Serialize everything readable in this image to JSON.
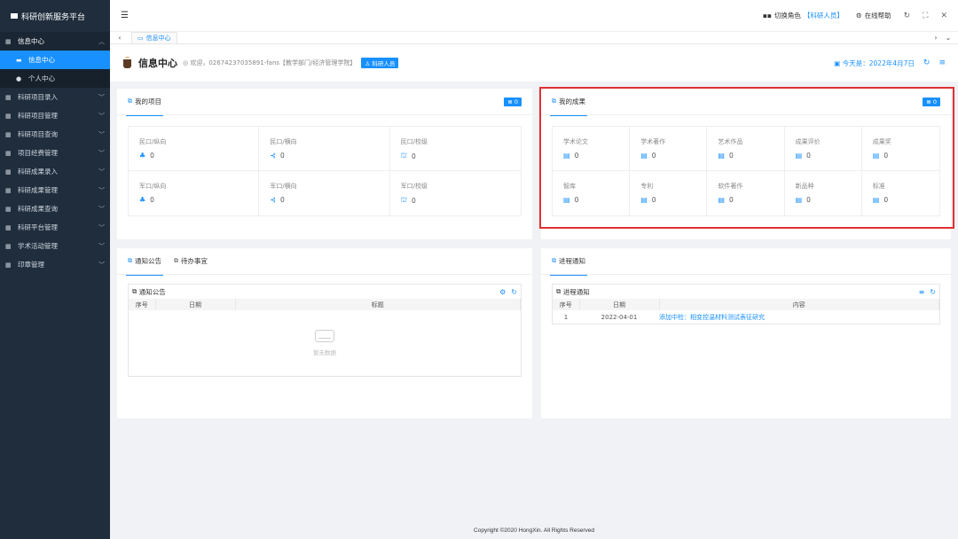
{
  "brand": {
    "title": "科研创新服务平台"
  },
  "sidebar": {
    "items": [
      {
        "label": "信息中心",
        "open": true
      },
      {
        "label": "科研项目录入"
      },
      {
        "label": "科研项目管理"
      },
      {
        "label": "科研项目查询"
      },
      {
        "label": "项目经费管理"
      },
      {
        "label": "科研成果录入"
      },
      {
        "label": "科研成果管理"
      },
      {
        "label": "科研成果查询"
      },
      {
        "label": "科研平台管理"
      },
      {
        "label": "学术活动管理"
      },
      {
        "label": "印章管理"
      }
    ],
    "subitems": [
      {
        "label": "信息中心",
        "active": true
      },
      {
        "label": "个人中心"
      }
    ]
  },
  "topbar": {
    "switch_role_label": "切换角色",
    "role_value": "【科研人员】",
    "help_label": "在线帮助"
  },
  "tabs": [
    {
      "label": "信息中心"
    }
  ],
  "page_header": {
    "title": "信息中心",
    "welcome": "欢迎，02674237035891-fans【教学部门/经济管理学院】",
    "role_badge": "科研人员",
    "today": "今天是：2022年4月7日"
  },
  "my_projects": {
    "title": "我的项目",
    "count": "0",
    "cells": [
      {
        "label": "民口/纵向",
        "value": "0",
        "icon": "hierarchy-icon"
      },
      {
        "label": "民口/横向",
        "value": "0",
        "icon": "share-icon"
      },
      {
        "label": "民口/校级",
        "value": "0",
        "icon": "bank-icon"
      },
      {
        "label": "军口/纵向",
        "value": "0",
        "icon": "hierarchy-icon"
      },
      {
        "label": "军口/横向",
        "value": "0",
        "icon": "share-icon"
      },
      {
        "label": "军口/校级",
        "value": "0",
        "icon": "bank-icon"
      }
    ]
  },
  "my_achievements": {
    "title": "我的成果",
    "count": "0",
    "cells": [
      {
        "label": "学术论文",
        "value": "0"
      },
      {
        "label": "学术著作",
        "value": "0"
      },
      {
        "label": "艺术作品",
        "value": "0"
      },
      {
        "label": "成果评价",
        "value": "0"
      },
      {
        "label": "成果奖",
        "value": "0"
      },
      {
        "label": "智库",
        "value": "0"
      },
      {
        "label": "专利",
        "value": "0"
      },
      {
        "label": "软件著作",
        "value": "0"
      },
      {
        "label": "新品种",
        "value": "0"
      },
      {
        "label": "标准",
        "value": "0"
      }
    ]
  },
  "notices": {
    "tab1": "通知公告",
    "tab2": "待办事宜",
    "panel_title": "通知公告",
    "columns": [
      "序号",
      "日期",
      "标题"
    ],
    "empty_text": "暂无数据"
  },
  "progress": {
    "tab": "进程通知",
    "panel_title": "进程通知",
    "columns": [
      "序号",
      "日期",
      "内容"
    ],
    "rows": [
      {
        "no": "1",
        "date": "2022-04-01",
        "content": "添加中检：相变控温材料测试表征研究"
      }
    ]
  },
  "footer": {
    "copyright": "Copyright ©2020 HongXin. All Rights Reserved"
  },
  "colors": {
    "accent": "#1890ff",
    "sidebar_bg": "#1f2d3d",
    "highlight": "#e03030"
  }
}
